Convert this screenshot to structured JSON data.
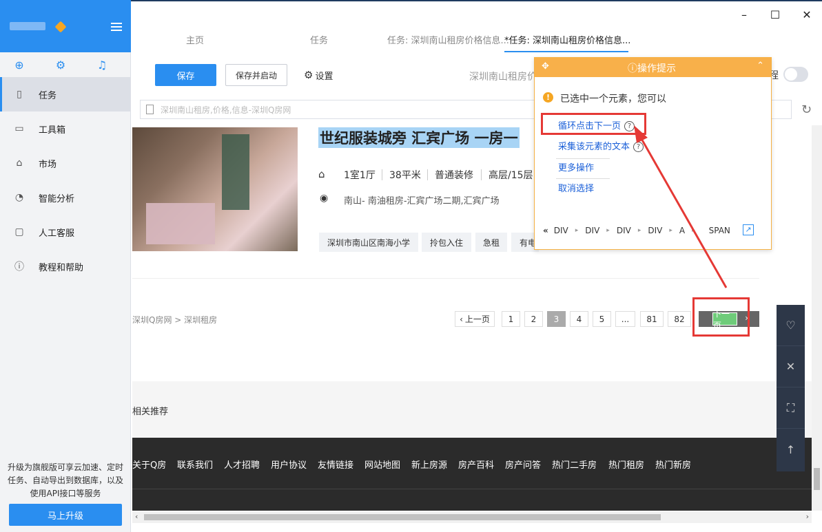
{
  "sidebar": {
    "items": [
      {
        "label": "任务",
        "icon": "document-icon"
      },
      {
        "label": "工具箱",
        "icon": "toolbox-icon"
      },
      {
        "label": "市场",
        "icon": "bag-icon"
      },
      {
        "label": "智能分析",
        "icon": "pie-chart-icon"
      },
      {
        "label": "人工客服",
        "icon": "chat-icon"
      },
      {
        "label": "教程和帮助",
        "icon": "help-icon"
      }
    ],
    "promo_text": "升级为旗舰版可享云加速、定时任务、自动导出到数据库，以及使用API接口等服务",
    "upgrade_label": "马上升级"
  },
  "tabs": [
    {
      "label": "主页"
    },
    {
      "label": "任务"
    },
    {
      "label": "任务: 深圳南山租房价格信息..."
    },
    {
      "label": "*任务: 深圳南山租房价格信息..."
    }
  ],
  "toolbar": {
    "save_label": "保存",
    "save_run_label": "保存并启动",
    "settings_label": "设置",
    "task_title": "深圳南山租房价",
    "toggle_label": "程"
  },
  "url_bar": {
    "text": "深圳南山租房,价格,信息-深圳Q房网"
  },
  "listing": {
    "title": "世纪服装城旁 汇宾广场 一房一",
    "layout": "1室1厅",
    "area": "38平米",
    "decoration": "普通装修",
    "floor": "高层/15层",
    "location": "南山- 南油租房-汇宾广场二期,汇宾广场",
    "tags": [
      "深圳市南山区南海小学",
      "拎包入住",
      "急租",
      "有电"
    ]
  },
  "breadcrumb": "深圳Q房网 > 深圳租房",
  "pagination": {
    "prev_label": "上一页",
    "pages": [
      "1",
      "2",
      "3",
      "4",
      "5",
      "...",
      "81",
      "82"
    ],
    "current": "3",
    "next_label": "下一页"
  },
  "related_label": "相关推荐",
  "footer_links": [
    "关于Q房",
    "联系我们",
    "人才招聘",
    "用户协议",
    "友情链接",
    "网站地图",
    "新上房源",
    "房产百科",
    "房产问答",
    "热门二手房",
    "热门租房",
    "热门新房"
  ],
  "tip_panel": {
    "title": "操作提示",
    "message": "已选中一个元素，您可以",
    "actions": [
      "循环点击下一页",
      "采集该元素的文本",
      "更多操作",
      "取消选择"
    ],
    "path": [
      "DIV",
      "DIV",
      "DIV",
      "DIV",
      "A",
      "SPAN"
    ]
  },
  "colors": {
    "accent": "#2a8ef0",
    "tip_header": "#f8b04a",
    "annotation": "#e53935",
    "footer_bg": "#2b2b2b"
  }
}
